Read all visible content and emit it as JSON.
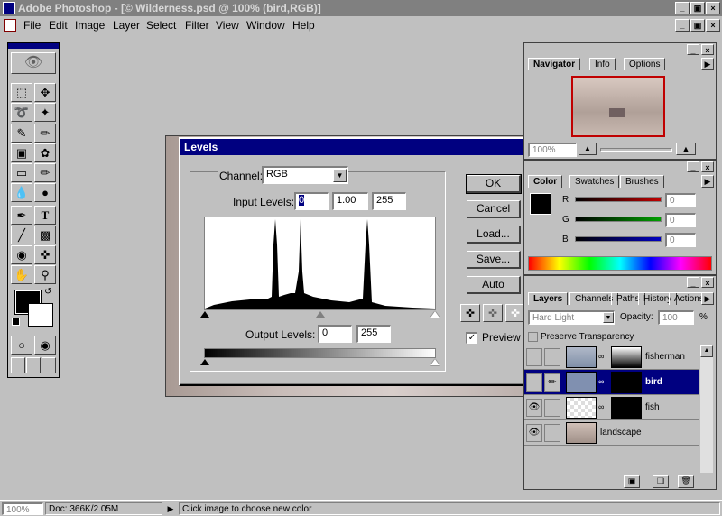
{
  "window": {
    "title": "Adobe Photoshop - [© Wilderness.psd @ 100% (bird,RGB)]",
    "buttons": [
      "_",
      "□",
      "×"
    ]
  },
  "menu": [
    "File",
    "Edit",
    "Image",
    "Layer",
    "Select",
    "Filter",
    "View",
    "Window",
    "Help"
  ],
  "levels": {
    "title": "Levels",
    "channel_label": "Channel:",
    "channel_value": "RGB",
    "input_levels_label": "Input Levels:",
    "input_black": "0",
    "input_gamma": "1.00",
    "input_white": "255",
    "output_levels_label": "Output Levels:",
    "output_black": "0",
    "output_white": "255",
    "buttons": {
      "ok": "OK",
      "cancel": "Cancel",
      "load": "Load...",
      "save": "Save...",
      "auto": "Auto"
    },
    "preview_label": "Preview",
    "preview_checked": true
  },
  "navigator": {
    "tabs": [
      "Navigator",
      "Info",
      "Options"
    ],
    "zoom": "100%"
  },
  "color_panel": {
    "tabs": [
      "Color",
      "Swatches",
      "Brushes"
    ],
    "channels": [
      {
        "label": "R",
        "value": "0"
      },
      {
        "label": "G",
        "value": "0"
      },
      {
        "label": "B",
        "value": "0"
      }
    ],
    "colors": {
      "r": "#c00000",
      "g": "#00a000",
      "b": "#0000c0"
    }
  },
  "layers_panel": {
    "tabs": [
      "Layers",
      "Channels",
      "Paths",
      "History",
      "Actions"
    ],
    "mode": "Hard Light",
    "opacity_label": "Opacity:",
    "opacity_value": "100",
    "opacity_unit": "%",
    "preserve_label": "Preserve Transparency",
    "layers": [
      {
        "name": "fisherman",
        "visible": false,
        "selected": false
      },
      {
        "name": "bird",
        "visible": false,
        "selected": true
      },
      {
        "name": "fish",
        "visible": true,
        "selected": false
      },
      {
        "name": "landscape",
        "visible": true,
        "selected": false
      }
    ]
  },
  "status": {
    "zoom": "100%",
    "doc": "Doc: 366K/2.05M",
    "hint": "Click image to choose new color"
  }
}
